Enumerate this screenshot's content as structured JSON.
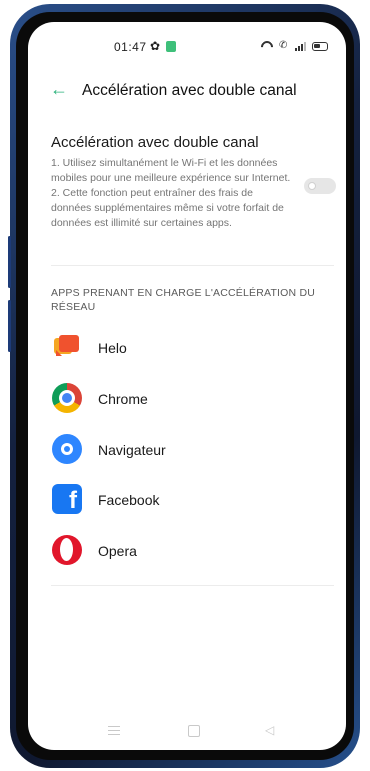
{
  "status_bar": {
    "time": "01:47"
  },
  "header": {
    "back_icon": "arrow-left-icon",
    "title": "Accélération avec double canal"
  },
  "setting": {
    "title": "Accélération avec double canal",
    "description_lines": [
      "1. Utilisez simultanément le Wi-Fi et les données mobiles pour une meilleure expérience sur Internet.",
      "2. Cette fonction peut entraîner des frais de données supplémentaires même si votre forfait de données est illimité sur certaines apps."
    ],
    "toggle_state": "off"
  },
  "apps_section": {
    "header": "APPS PRENANT EN CHARGE L'ACCÉLÉRATION DU RÉSEAU",
    "apps": [
      {
        "name": "Helo",
        "icon": "helo-icon"
      },
      {
        "name": "Chrome",
        "icon": "chrome-icon"
      },
      {
        "name": "Navigateur",
        "icon": "navigateur-icon"
      },
      {
        "name": "Facebook",
        "icon": "facebook-icon"
      },
      {
        "name": "Opera",
        "icon": "opera-icon"
      }
    ]
  },
  "colors": {
    "accent": "#2ab27b",
    "phone_frame": "#14213f"
  }
}
